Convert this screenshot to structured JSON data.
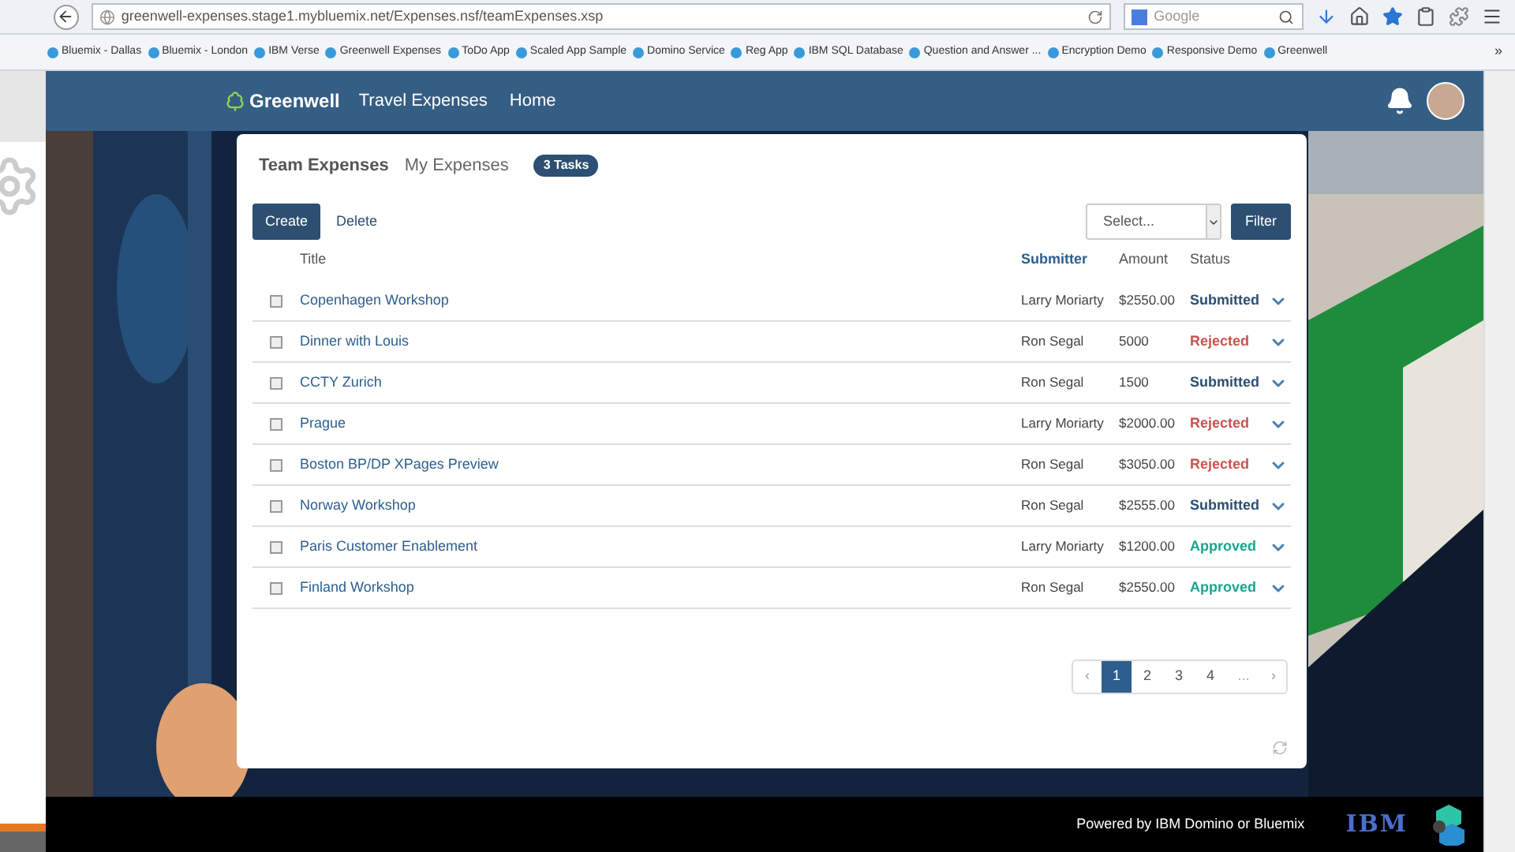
{
  "browser": {
    "url": "greenwell-expenses.stage1.mybluemix.net/Expenses.nsf/teamExpenses.xsp",
    "search": {
      "placeholder": "Google"
    },
    "bookmarks": [
      "Bluemix - Dallas",
      "Bluemix - London",
      "IBM Verse",
      "Greenwell Expenses",
      "ToDo App",
      "Scaled App Sample",
      "Domino Service",
      "Reg App",
      "IBM SQL Database",
      "Question and Answer ...",
      "Encryption Demo",
      "Responsive Demo",
      "Greenwell"
    ],
    "more": "»"
  },
  "header": {
    "brand": "Greenwell",
    "nav": [
      "Travel Expenses",
      "Home"
    ]
  },
  "tabs": [
    {
      "label": "Team Expenses",
      "selected": true
    },
    {
      "label": "My Expenses",
      "selected": false
    }
  ],
  "tasks_badge": "3 Tasks",
  "toolbar": {
    "create": "Create",
    "delete": "Delete",
    "select": {
      "placeholder": "Select..."
    },
    "filter": "Filter"
  },
  "table": {
    "columns": [
      "Title",
      "Submitter",
      "Amount",
      "Status"
    ],
    "rows": [
      {
        "checked": false,
        "title": "Copenhagen Workshop",
        "submitter": "Larry Moriarty",
        "amount": "$2550.00",
        "status": "Submitted",
        "kind": "submitted"
      },
      {
        "checked": false,
        "title": "Dinner with Louis",
        "submitter": "Ron Segal",
        "amount": "5000",
        "status": "Rejected",
        "kind": "rejected"
      },
      {
        "checked": false,
        "title": "CCTY Zurich",
        "submitter": "Ron Segal",
        "amount": "1500",
        "status": "Submitted",
        "kind": "submitted"
      },
      {
        "checked": false,
        "title": "Prague",
        "submitter": "Larry Moriarty",
        "amount": "$2000.00",
        "status": "Rejected",
        "kind": "rejected"
      },
      {
        "checked": false,
        "title": "Boston BP/DP XPages Preview",
        "submitter": "Ron Segal",
        "amount": "$3050.00",
        "status": "Rejected",
        "kind": "rejected"
      },
      {
        "checked": false,
        "title": "Norway Workshop",
        "submitter": "Ron Segal",
        "amount": "$2555.00",
        "status": "Submitted",
        "kind": "submitted"
      },
      {
        "checked": false,
        "title": "Paris Customer Enablement",
        "submitter": "Larry Moriarty",
        "amount": "$1200.00",
        "status": "Approved",
        "kind": "approved"
      },
      {
        "checked": false,
        "title": "Finland Workshop",
        "submitter": "Ron Segal",
        "amount": "$2550.00",
        "status": "Approved",
        "kind": "approved"
      }
    ]
  },
  "pagination": {
    "prev": "‹",
    "pages": [
      {
        "label": "1",
        "selected": true
      },
      {
        "label": "2",
        "selected": false
      },
      {
        "label": "3",
        "selected": false
      },
      {
        "label": "4",
        "selected": false
      }
    ],
    "ellipsis": "...",
    "next": "›"
  },
  "footer": {
    "text": "Powered by IBM Domino or Bluemix",
    "logo": "IBM"
  }
}
